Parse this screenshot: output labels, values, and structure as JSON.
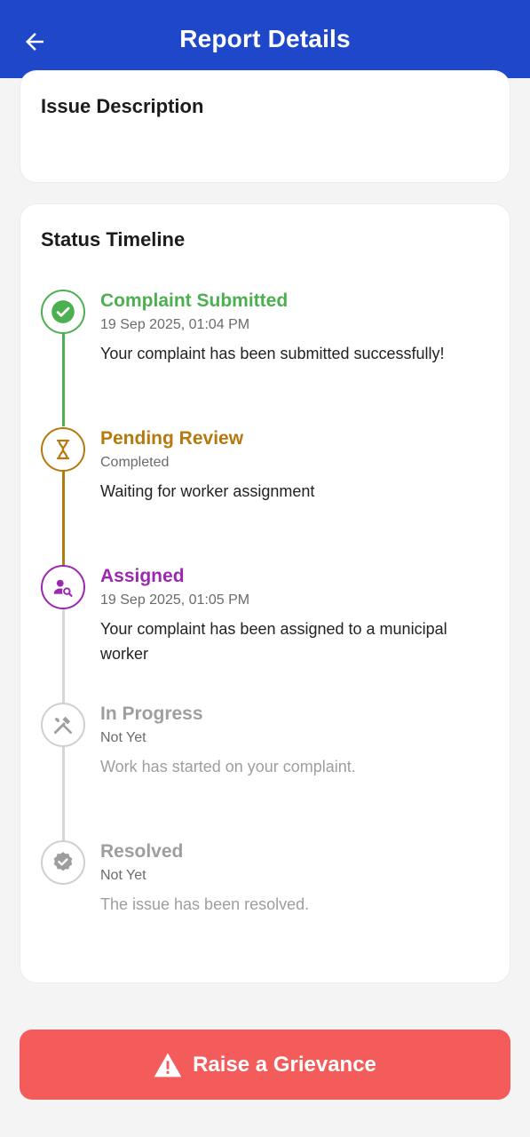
{
  "app_bar": {
    "title": "Report Details",
    "back_icon": "arrow-back-icon",
    "background": "#1e47c9"
  },
  "description_card": {
    "heading": "Issue Description"
  },
  "timeline_card": {
    "heading": "Status Timeline",
    "steps": [
      {
        "title": "Complaint Submitted",
        "date": "19 Sep 2025, 01:04 PM",
        "message": "Your complaint has been submitted successfully!",
        "icon": "check-circle-icon",
        "color": "#4caf50"
      },
      {
        "title": "Pending Review",
        "date": "Completed",
        "message": "Waiting for worker assignment",
        "icon": "hourglass-icon",
        "color": "#b5790e"
      },
      {
        "title": "Assigned",
        "date": "19 Sep 2025, 01:05 PM",
        "message": "Your complaint has been assigned to a municipal worker",
        "icon": "person-search-icon",
        "color": "#9c27b0"
      },
      {
        "title": "In Progress",
        "date": "Not Yet",
        "message": "Work has started on your complaint.",
        "icon": "tools-icon",
        "color": "#bdbdbd"
      },
      {
        "title": "Resolved",
        "date": "Not Yet",
        "message": "The issue has been resolved.",
        "icon": "verified-badge-icon",
        "color": "#bdbdbd"
      }
    ]
  },
  "grievance_button": {
    "label": "Raise a Grievance",
    "icon": "warning-icon",
    "background": "#f45b5b"
  }
}
